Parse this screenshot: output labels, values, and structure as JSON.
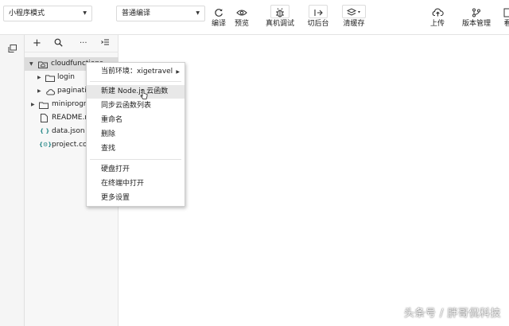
{
  "toolbar": {
    "mode_select": "小程序模式",
    "compile_select": "普通编译",
    "buttons": {
      "compile": "编译",
      "preview": "预览",
      "remote_debug": "真机调试",
      "background": "切后台",
      "clear_cache": "清缓存",
      "upload": "上传",
      "version_mgmt": "版本管理",
      "detail_partial": "看"
    }
  },
  "explorer": {
    "head": {
      "add": "+",
      "search": "search",
      "more": "···",
      "collapse": "collapse"
    },
    "tree": [
      {
        "name": "cloudfunctions",
        "type": "cloud-folder",
        "expanded": true
      },
      {
        "name": "login",
        "type": "folder"
      },
      {
        "name": "pagination",
        "type": "cloud-folder"
      },
      {
        "name": "miniprogram",
        "type": "folder"
      },
      {
        "name": "README.md",
        "type": "file"
      },
      {
        "name": "data.json",
        "type": "json"
      },
      {
        "name": "project.config.json",
        "type": "config"
      }
    ]
  },
  "context_menu": {
    "items": [
      {
        "label": "当前环境：xigetravel",
        "has_submenu": true
      },
      {
        "label": "新建 Node.js 云函数",
        "hover": true
      },
      {
        "label": "同步云函数列表"
      },
      {
        "label": "重命名"
      },
      {
        "label": "删除"
      },
      {
        "label": "查找"
      },
      {
        "label": "硬盘打开"
      },
      {
        "label": "在终端中打开"
      },
      {
        "label": "更多设置"
      }
    ]
  },
  "watermark": "头条号 / 胖哥侃科技",
  "colors": {
    "selected_row": "#dcdcdc",
    "menu_hover": "#e8e8e8",
    "border": "#e3e3e3"
  }
}
